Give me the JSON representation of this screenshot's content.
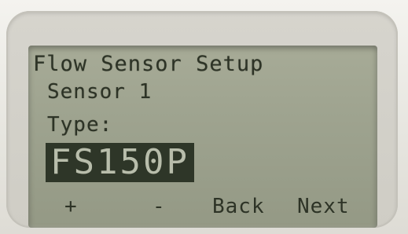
{
  "screen": {
    "title": "Flow Sensor Setup",
    "subtitle": "Sensor 1",
    "field_label": "Type:",
    "field_value": "FS150P"
  },
  "softkeys": {
    "plus": "+",
    "minus": "-",
    "back": "Back",
    "next": "Next"
  },
  "colors": {
    "lcd_background": "#9ea38f",
    "lcd_text": "#2d3326",
    "highlight_background": "#2e3628",
    "highlight_text": "#b8bdab"
  }
}
